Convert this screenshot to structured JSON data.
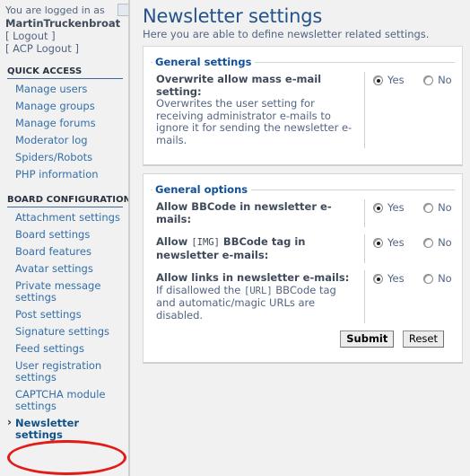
{
  "sidebar": {
    "logged_in_text": "You are logged in as",
    "username": "MartinTruckenbroat",
    "logout_label": "[ Logout ]",
    "acp_logout_label": "[ ACP Logout ]",
    "collapse_icon": "triangle-left-icon",
    "sections": [
      {
        "heading": "QUICK ACCESS",
        "items": [
          {
            "label": "Manage users",
            "active": false
          },
          {
            "label": "Manage groups",
            "active": false
          },
          {
            "label": "Manage forums",
            "active": false
          },
          {
            "label": "Moderator log",
            "active": false
          },
          {
            "label": "Spiders/Robots",
            "active": false
          },
          {
            "label": "PHP information",
            "active": false
          }
        ]
      },
      {
        "heading": "BOARD CONFIGURATION",
        "items": [
          {
            "label": "Attachment settings",
            "active": false
          },
          {
            "label": "Board settings",
            "active": false
          },
          {
            "label": "Board features",
            "active": false
          },
          {
            "label": "Avatar settings",
            "active": false
          },
          {
            "label": "Private message settings",
            "active": false
          },
          {
            "label": "Post settings",
            "active": false
          },
          {
            "label": "Signature settings",
            "active": false
          },
          {
            "label": "Feed settings",
            "active": false
          },
          {
            "label": "User registration settings",
            "active": false
          },
          {
            "label": "CAPTCHA module settings",
            "active": false
          },
          {
            "label": "Newsletter settings",
            "active": true
          }
        ]
      }
    ]
  },
  "annotation": {
    "shape": "ellipse",
    "color": "#e01b18",
    "target": "Newsletter settings"
  },
  "main": {
    "title": "Newsletter settings",
    "description": "Here you are able to define newsletter related settings.",
    "fieldsets": [
      {
        "legend": "General settings",
        "rows": [
          {
            "label": "Overwrite allow mass e-mail setting:",
            "label_mono": "",
            "desc_before": "Overwrites the user setting for receiving administrator e-mails to ignore it for sending the newsletter e-mails.",
            "desc_mono": "",
            "desc_after": "",
            "yes_label": "Yes",
            "no_label": "No",
            "selected": "Yes"
          }
        ]
      },
      {
        "legend": "General options",
        "rows": [
          {
            "label": "Allow BBCode in newsletter e-mails:",
            "label_mono": "",
            "desc_before": "",
            "desc_mono": "",
            "desc_after": "",
            "yes_label": "Yes",
            "no_label": "No",
            "selected": "Yes"
          },
          {
            "label_pre": "Allow ",
            "label_mono": "[IMG]",
            "label_post": " BBCode tag in newsletter e-mails:",
            "label": "",
            "desc_before": "",
            "desc_mono": "",
            "desc_after": "",
            "yes_label": "Yes",
            "no_label": "No",
            "selected": "Yes"
          },
          {
            "label": "Allow links in newsletter e-mails:",
            "label_mono": "",
            "desc_before": "If disallowed the ",
            "desc_mono": "[URL]",
            "desc_after": " BBCode tag and automatic/magic URLs are disabled.",
            "yes_label": "Yes",
            "no_label": "No",
            "selected": "Yes"
          }
        ]
      }
    ],
    "buttons": {
      "submit_label": "Submit",
      "reset_label": "Reset"
    }
  }
}
